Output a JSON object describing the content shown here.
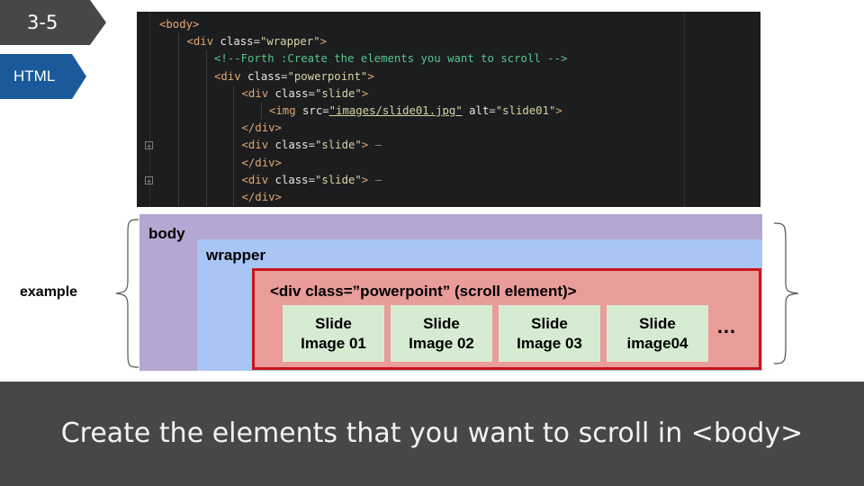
{
  "badges": {
    "number": "3-5",
    "language": "HTML"
  },
  "code_lines": [
    {
      "indent": 0,
      "parts": [
        [
          "tag",
          "<body>"
        ]
      ]
    },
    {
      "indent": 1,
      "parts": [
        [
          "tag",
          "<div "
        ],
        [
          "attr",
          "class"
        ],
        [
          "eq",
          "="
        ],
        [
          "str",
          "\"wrapper\""
        ],
        [
          "tag",
          ">"
        ]
      ]
    },
    {
      "indent": 2,
      "parts": [
        [
          "com",
          "<!--Forth :Create the elements you want to scroll -->"
        ]
      ]
    },
    {
      "indent": 2,
      "parts": [
        [
          "tag",
          "<div "
        ],
        [
          "attr",
          "class"
        ],
        [
          "eq",
          "="
        ],
        [
          "str",
          "\"powerpoint\""
        ],
        [
          "tag",
          ">"
        ]
      ]
    },
    {
      "indent": 3,
      "parts": [
        [
          "tag",
          "<div "
        ],
        [
          "attr",
          "class"
        ],
        [
          "eq",
          "="
        ],
        [
          "str",
          "\"slide\""
        ],
        [
          "tag",
          ">"
        ]
      ]
    },
    {
      "indent": 4,
      "parts": [
        [
          "tag",
          "<img "
        ],
        [
          "attr",
          "src"
        ],
        [
          "eq",
          "="
        ],
        [
          "str-u",
          "\"images/slide01.jpg\""
        ],
        [
          "attr",
          " alt"
        ],
        [
          "eq",
          "="
        ],
        [
          "str",
          "\"slide01\""
        ],
        [
          "tag",
          ">"
        ]
      ]
    },
    {
      "indent": 3,
      "parts": [
        [
          "tag",
          "</div>"
        ]
      ]
    },
    {
      "indent": 3,
      "fold": true,
      "parts": [
        [
          "tag",
          "<div "
        ],
        [
          "attr",
          "class"
        ],
        [
          "eq",
          "="
        ],
        [
          "str",
          "\"slide\""
        ],
        [
          "tag",
          ">"
        ],
        [
          "dim",
          " –"
        ]
      ]
    },
    {
      "indent": 3,
      "parts": [
        [
          "tag",
          "</div>"
        ]
      ]
    },
    {
      "indent": 3,
      "fold": true,
      "parts": [
        [
          "tag",
          "<div "
        ],
        [
          "attr",
          "class"
        ],
        [
          "eq",
          "="
        ],
        [
          "str",
          "\"slide\""
        ],
        [
          "tag",
          ">"
        ],
        [
          "dim",
          " –"
        ]
      ]
    },
    {
      "indent": 3,
      "parts": [
        [
          "tag",
          "</div>"
        ]
      ]
    }
  ],
  "diagram": {
    "example_label": "example",
    "body_label": "body",
    "wrapper_label": "wrapper",
    "powerpoint_label": "<div class=”powerpoint” (scroll element)>",
    "slides": [
      "Slide\nImage 01",
      "Slide\nImage 02",
      "Slide\nImage 03",
      "Slide\nimage04"
    ],
    "ellipsis": "…"
  },
  "footer": {
    "caption": "Create the elements that you want to scroll in <body>"
  },
  "colors": {
    "badge_dark": "#474747",
    "badge_blue": "#1b5a9a",
    "code_bg": "#1c1d1f",
    "body_purple": "#b5a6d2",
    "wrapper_blue": "#a8c5f3",
    "powerpoint_red": "#e99c9a",
    "powerpoint_border": "#c8141b",
    "slide_green": "#d6ecd2",
    "footer_bg": "#474747"
  }
}
